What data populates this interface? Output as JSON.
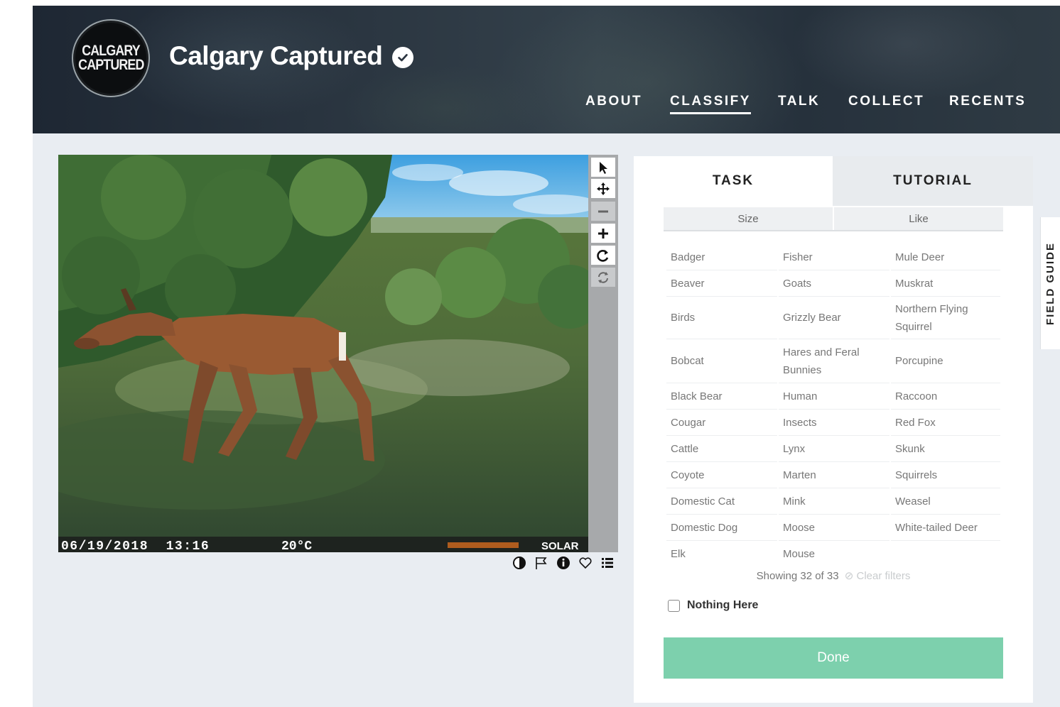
{
  "header": {
    "logo_lines": [
      "CALGARY",
      "CAPTURED"
    ],
    "title": "Calgary Captured",
    "nav": [
      {
        "label": "ABOUT",
        "active": false
      },
      {
        "label": "CLASSIFY",
        "active": true
      },
      {
        "label": "TALK",
        "active": false
      },
      {
        "label": "COLLECT",
        "active": false
      },
      {
        "label": "RECENTS",
        "active": false
      }
    ]
  },
  "viewer": {
    "timestamp": "06/19/2018  13:16",
    "temperature": "20°C",
    "camera_brand": "SOLAR",
    "tools": [
      "pointer-icon",
      "move-icon",
      "zoom-out-icon",
      "zoom-in-icon",
      "rotate-icon",
      "reset-icon"
    ],
    "bottom_icons": [
      "contrast-icon",
      "flag-icon",
      "info-icon",
      "heart-icon",
      "collections-icon"
    ]
  },
  "panel": {
    "tabs": [
      "TASK",
      "TUTORIAL"
    ],
    "filters": [
      "Size",
      "Like"
    ],
    "species_columns": [
      [
        "Badger",
        "Beaver",
        "Birds",
        "Bobcat",
        "Black Bear",
        "Cougar",
        "Cattle",
        "Coyote",
        "Domestic Cat",
        "Domestic Dog",
        "Elk"
      ],
      [
        "Fisher",
        "Goats",
        "Grizzly Bear",
        "Hares and Feral Bunnies",
        "Human",
        "Insects",
        "Lynx",
        "Marten",
        "Mink",
        "Moose",
        "Mouse"
      ],
      [
        "Mule Deer",
        "Muskrat",
        "Northern Flying Squirrel",
        "Porcupine",
        "Raccoon",
        "Red Fox",
        "Skunk",
        "Squirrels",
        "Weasel",
        "White-tailed Deer"
      ]
    ],
    "showing": "Showing 32 of 33",
    "clear_filters": "Clear filters",
    "nothing_here": "Nothing Here",
    "done": "Done"
  },
  "field_guide": "FIELD GUIDE"
}
